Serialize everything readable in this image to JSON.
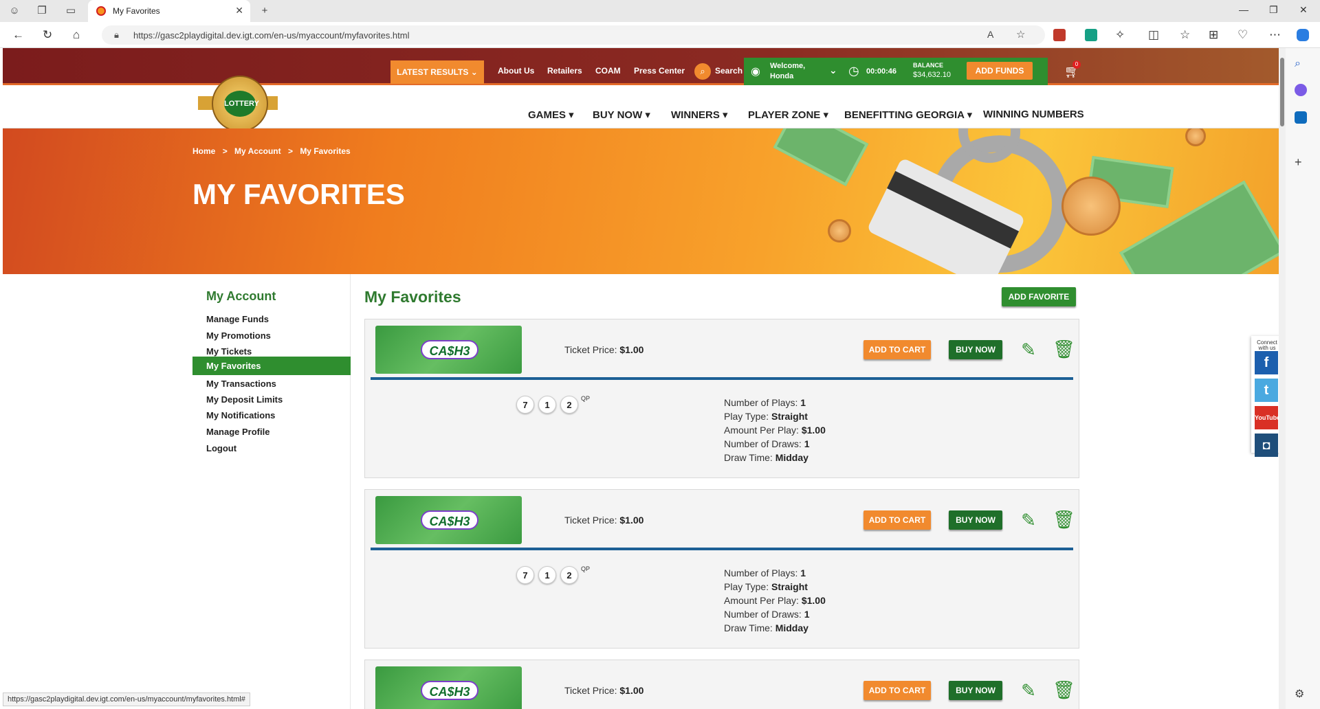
{
  "browser": {
    "tab_title": "My Favorites",
    "url": "https://gasc2playdigital.dev.igt.com/en-us/myaccount/myfavorites.html",
    "status_url": "https://gasc2playdigital.dev.igt.com/en-us/myaccount/myfavorites.html#"
  },
  "topbar": {
    "latest_results": "LATEST RESULTS",
    "about": "About Us",
    "retailers": "Retailers",
    "coam": "COAM",
    "press": "Press Center",
    "search": "Search",
    "welcome_line1": "Welcome,",
    "welcome_line2": "Honda",
    "timer": "00:00:46",
    "balance_label": "BALANCE",
    "balance_value": "$34,632.10",
    "add_funds": "ADD FUNDS",
    "cart_count": "0"
  },
  "logo": {
    "text": "LOTTERY"
  },
  "nav": [
    "GAMES",
    "BUY NOW",
    "WINNERS",
    "PLAYER ZONE",
    "BENEFITTING GEORGIA",
    "WINNING NUMBERS"
  ],
  "breadcrumb": [
    "Home",
    ">",
    "My Account",
    ">",
    "My Favorites"
  ],
  "hero_title": "MY FAVORITES",
  "sidebar": {
    "title": "My Account",
    "items": [
      "Manage Funds",
      "My Promotions",
      "My Tickets",
      "My Favorites",
      "My Transactions",
      "My Deposit Limits",
      "My Notifications",
      "Manage Profile",
      "Logout"
    ],
    "active_index": 3
  },
  "content": {
    "title": "My Favorites",
    "add_favorite": "ADD FAVORITE"
  },
  "favorites": [
    {
      "game_logo": "CA$H3",
      "ticket_price_label": "Ticket Price:",
      "ticket_price": "$1.00",
      "add_to_cart": "ADD TO CART",
      "buy_now": "BUY NOW",
      "numbers": [
        "7",
        "1",
        "2"
      ],
      "qp": "QP",
      "plays_label": "Number of Plays:",
      "plays": "1",
      "type_label": "Play Type:",
      "type": "Straight",
      "amount_label": "Amount Per Play:",
      "amount": "$1.00",
      "draws_label": "Number of Draws:",
      "draws": "1",
      "time_label": "Draw Time:",
      "time": "Midday"
    },
    {
      "game_logo": "CA$H3",
      "ticket_price_label": "Ticket Price:",
      "ticket_price": "$1.00",
      "add_to_cart": "ADD TO CART",
      "buy_now": "BUY NOW",
      "numbers": [
        "7",
        "1",
        "2"
      ],
      "qp": "QP",
      "plays_label": "Number of Plays:",
      "plays": "1",
      "type_label": "Play Type:",
      "type": "Straight",
      "amount_label": "Amount Per Play:",
      "amount": "$1.00",
      "draws_label": "Number of Draws:",
      "draws": "1",
      "time_label": "Draw Time:",
      "time": "Midday"
    },
    {
      "game_logo": "CA$H3",
      "ticket_price_label": "Ticket Price:",
      "ticket_price": "$1.00",
      "add_to_cart": "ADD TO CART",
      "buy_now": "BUY NOW"
    }
  ],
  "connect": {
    "label": "Connect with us",
    "facebook": "f",
    "twitter": "t",
    "youtube": "YouTube",
    "instagram": "◘"
  }
}
